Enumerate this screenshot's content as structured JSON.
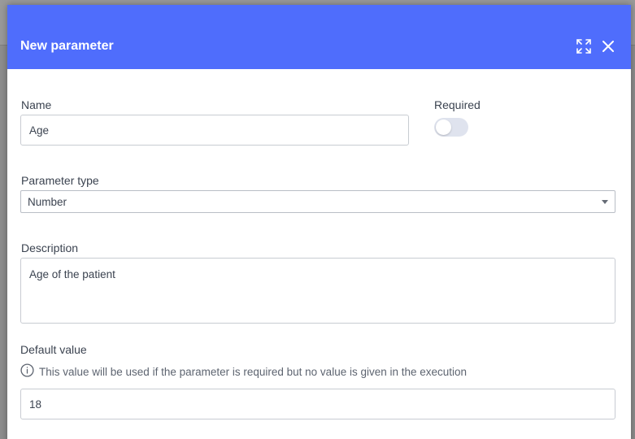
{
  "modal": {
    "title": "New parameter",
    "header_color": "#4f6dfc",
    "actions": {
      "expand_icon": "expand-icon",
      "close_icon": "close-icon"
    }
  },
  "form": {
    "name": {
      "label": "Name",
      "value": "Age"
    },
    "required": {
      "label": "Required",
      "checked": false
    },
    "parameter_type": {
      "label": "Parameter type",
      "value": "Number"
    },
    "description": {
      "label": "Description",
      "value": "Age of the patient"
    },
    "default_value": {
      "label": "Default value",
      "hint": "This value will be used if the parameter is required but no value is given in the execution",
      "hint_icon": "info-icon",
      "value": "18"
    }
  }
}
